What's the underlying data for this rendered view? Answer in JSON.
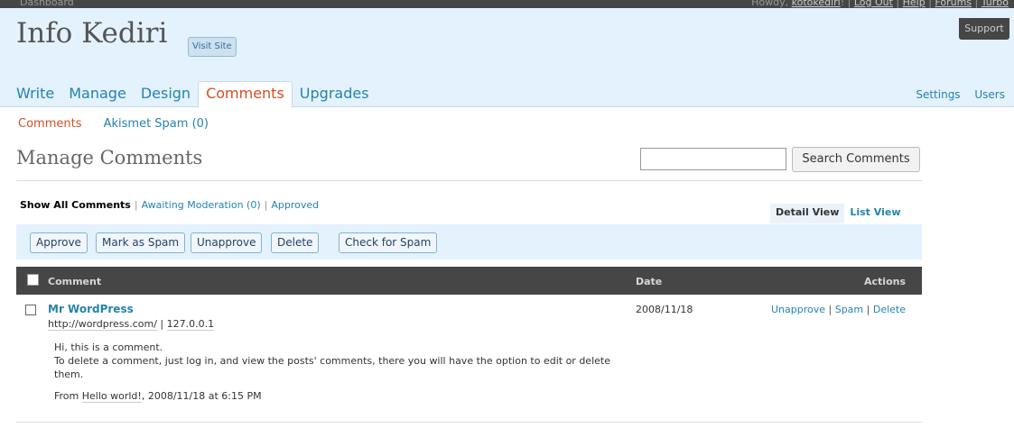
{
  "topbar": {
    "dashboard": "Dashboard",
    "howdy_prefix": "Howdy, ",
    "username": "kotokediri",
    "links": [
      "Log Out",
      "Help",
      "Forums",
      "Turbo"
    ]
  },
  "support": "Support",
  "header": {
    "site_title": "Info Kediri",
    "visit_site": "Visit Site"
  },
  "nav": {
    "tabs": [
      {
        "label": "Write"
      },
      {
        "label": "Manage"
      },
      {
        "label": "Design"
      },
      {
        "label": "Comments",
        "active": true
      },
      {
        "label": "Upgrades"
      }
    ],
    "right": [
      "Settings",
      "Users"
    ]
  },
  "subnav": {
    "current": "Comments",
    "other": "Akismet Spam (0)"
  },
  "page_title": "Manage Comments",
  "search": {
    "value": "",
    "button": "Search Comments"
  },
  "filters": {
    "current": "Show All Comments",
    "awaiting": "Awaiting Moderation (0)",
    "approved": "Approved"
  },
  "views": {
    "detail": "Detail View",
    "list": "List View"
  },
  "actions": {
    "approve": "Approve",
    "spam": "Mark as Spam",
    "unapprove": "Unapprove",
    "delete": "Delete",
    "check": "Check for Spam"
  },
  "table": {
    "headers": {
      "comment": "Comment",
      "date": "Date",
      "actions": "Actions"
    },
    "rows": [
      {
        "author": "Mr WordPress",
        "url": "http://wordpress.com/",
        "ip": "127.0.0.1",
        "body_1": "Hi, this is a comment.",
        "body_2": "To delete a comment, just log in, and view the posts' comments, there you will have the option to edit or delete them.",
        "from_prefix": "From ",
        "from_post": "Hello world!",
        "from_suffix": ", 2008/11/18 at 6:15 PM",
        "date": "2008/11/18",
        "row_actions": [
          "Unapprove",
          "Spam",
          "Delete"
        ]
      }
    ]
  },
  "colors": {
    "header_bg": "#e4f2fd",
    "link": "#2583ad",
    "active": "#d54e21",
    "table_head": "#464646"
  }
}
